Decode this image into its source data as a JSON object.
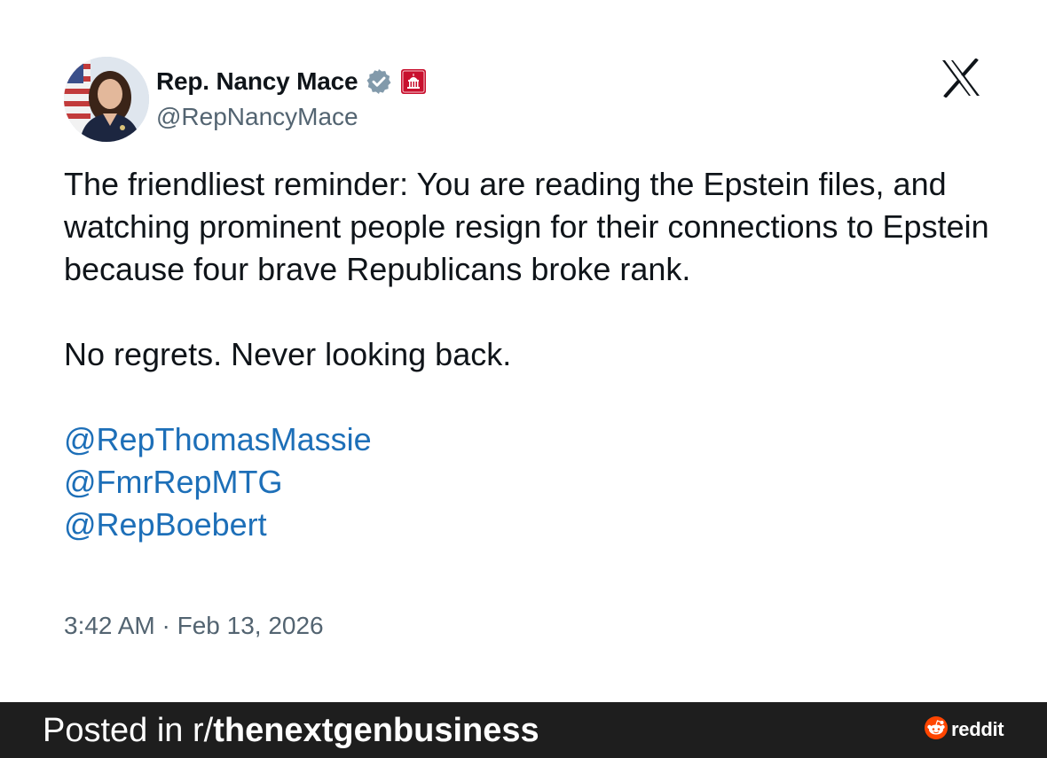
{
  "author": {
    "display_name": "Rep. Nancy Mace",
    "handle": "@RepNancyMace",
    "verified_badge_color": "#829aab",
    "gov_badge_color": "#c8102e"
  },
  "tweet": {
    "paragraphs": [
      "The friendliest reminder: You are reading the Epstein files, and watching prominent people resign for their connections to Epstein because four brave Republicans broke rank.",
      "No regrets. Never looking back."
    ],
    "mentions": [
      "@RepThomasMassie",
      "@FmrRepMTG",
      "@RepBoebert"
    ],
    "timestamp": "3:42 AM · Feb 13, 2026"
  },
  "footer": {
    "prefix": "Posted in r/",
    "subreddit": "thenextgenbusiness",
    "brand": "reddit"
  },
  "icons": {
    "verified": "verified-icon",
    "gov": "government-badge-icon",
    "x_logo": "x-logo-icon",
    "reddit": "reddit-logo-icon"
  },
  "colors": {
    "link": "#1d6fb8",
    "text": "#0f1419",
    "muted": "#536471",
    "footer_bg": "#1e1e1e",
    "reddit_orange": "#ff4500"
  }
}
